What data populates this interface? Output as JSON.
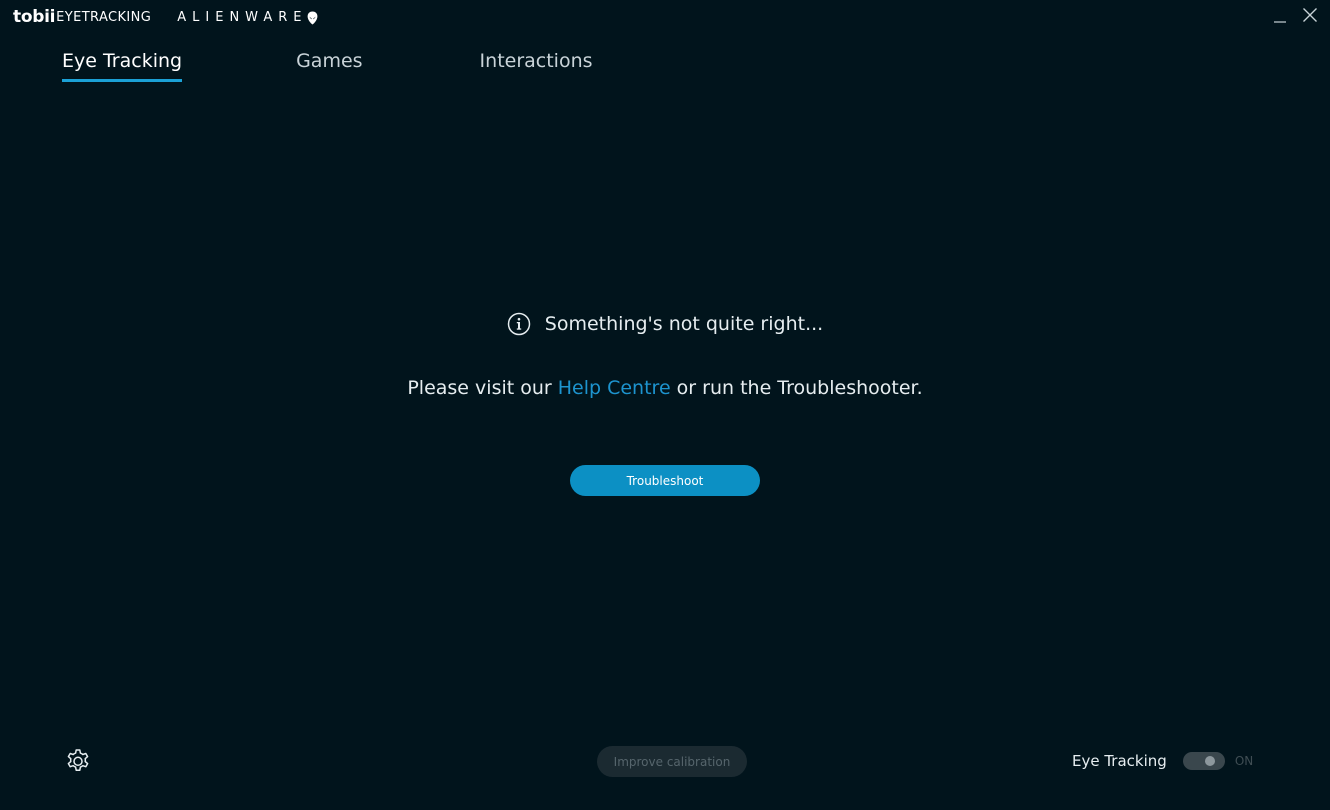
{
  "brand": {
    "tobii": "tobii",
    "eyetracking": "EYETRACKING",
    "alienware": "ALIENWARE"
  },
  "window": {
    "minimize_icon": "minimize-icon",
    "close_icon": "close-icon"
  },
  "tabs": [
    {
      "label": "Eye Tracking",
      "active": true
    },
    {
      "label": "Games",
      "active": false
    },
    {
      "label": "Interactions",
      "active": false
    }
  ],
  "status": {
    "icon": "info-icon",
    "message": "Something's not quite right..."
  },
  "help": {
    "prefix": "Please visit our ",
    "link": "Help Centre",
    "suffix": " or run the Troubleshooter."
  },
  "buttons": {
    "troubleshoot": "Troubleshoot",
    "improve_calibration": "Improve calibration"
  },
  "footer": {
    "settings_icon": "gear-icon",
    "toggle_label": "Eye Tracking",
    "toggle_state": "ON"
  },
  "colors": {
    "background": "#01141c",
    "accent": "#1ba1d6",
    "button": "#0c90c4",
    "link": "#1d94cf"
  }
}
